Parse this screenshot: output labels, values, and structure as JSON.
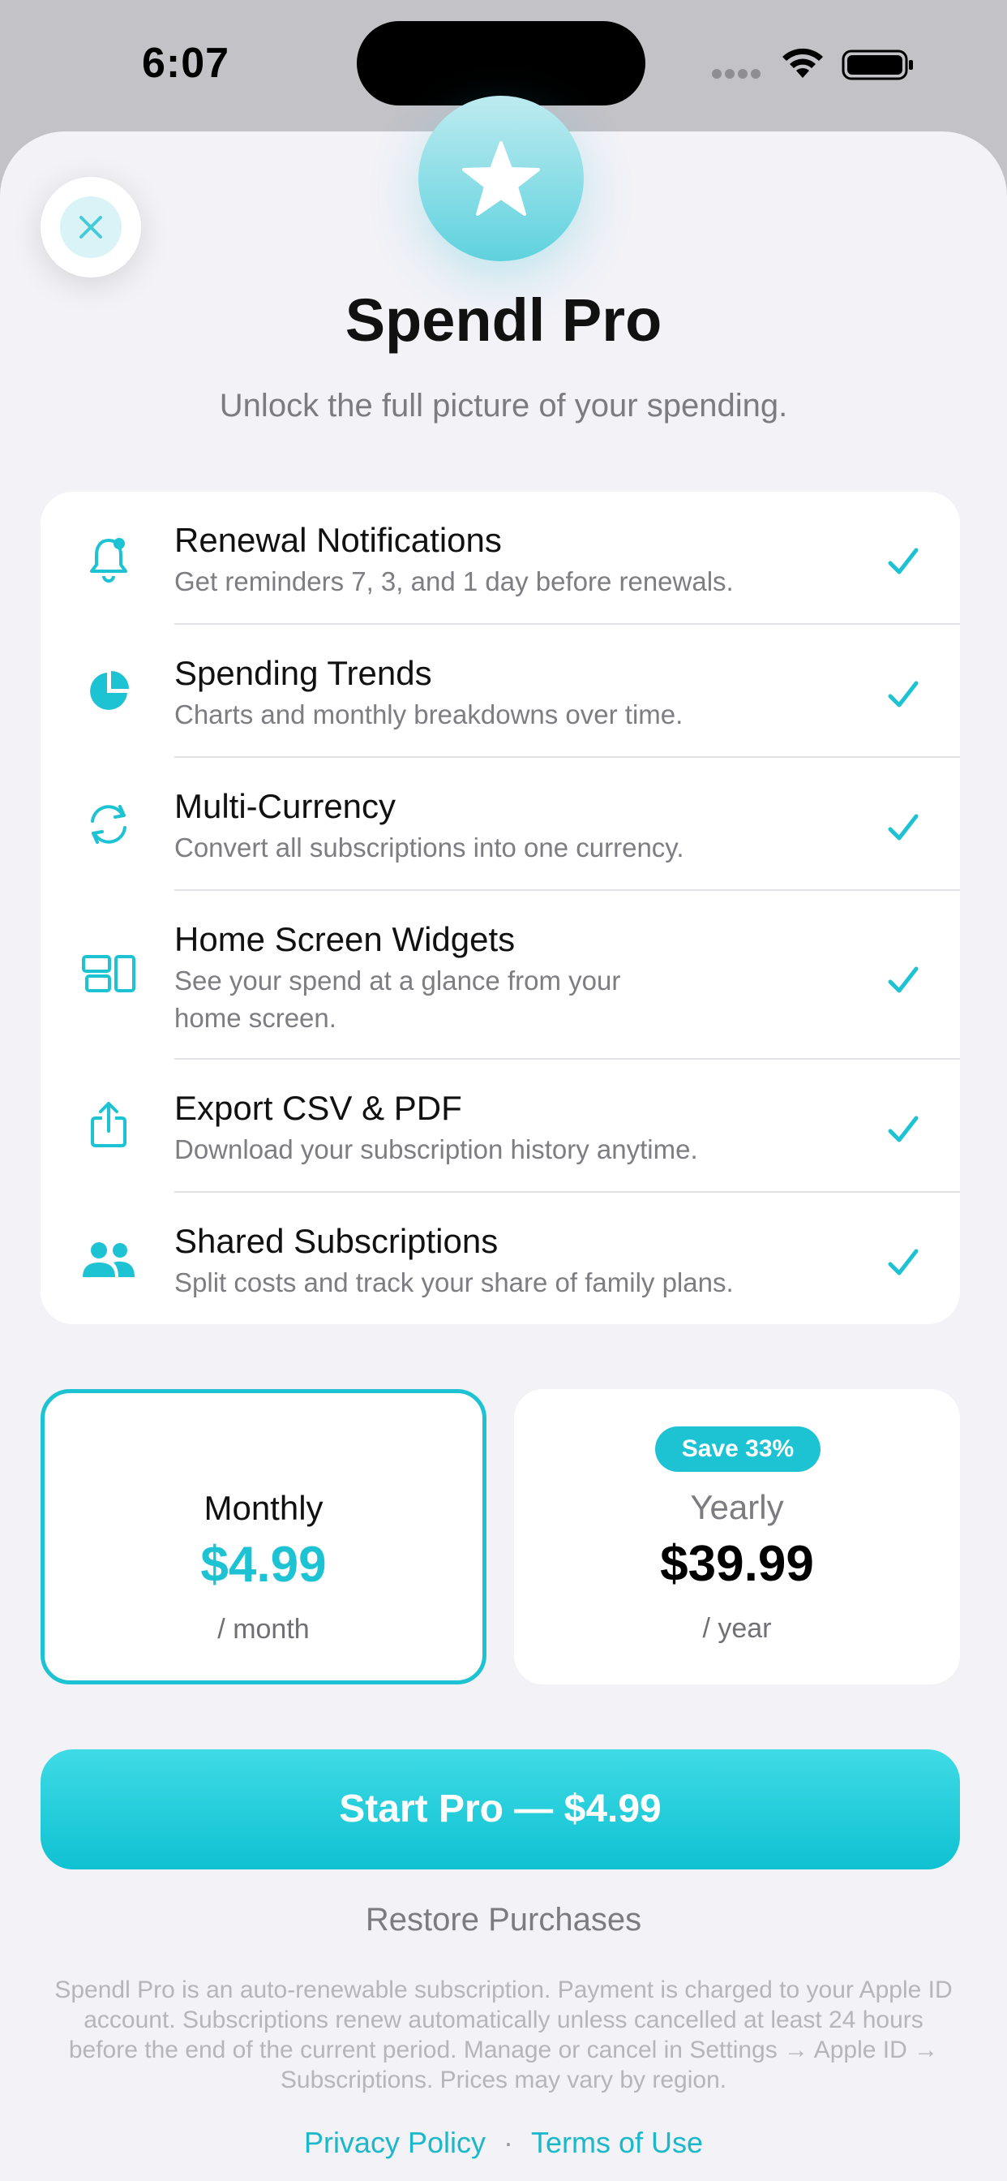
{
  "status_bar": {
    "time": "6:07"
  },
  "header": {
    "title": "Spendl Pro",
    "subtitle": "Unlock the full picture of your spending."
  },
  "features": [
    {
      "title": "Renewal Notifications",
      "desc": "Get reminders 7, 3, and 1 day before renewals.",
      "icon": "bell-icon"
    },
    {
      "title": "Spending Trends",
      "desc": "Charts and monthly breakdowns over time.",
      "icon": "pie-chart-icon"
    },
    {
      "title": "Multi-Currency",
      "desc": "Convert all subscriptions into one currency.",
      "icon": "refresh-icon"
    },
    {
      "title": "Home Screen Widgets",
      "desc": "See your spend at a glance from your home screen.",
      "icon": "widgets-icon"
    },
    {
      "title": "Export CSV & PDF",
      "desc": "Download your subscription history anytime.",
      "icon": "share-icon"
    },
    {
      "title": "Shared Subscriptions",
      "desc": "Split costs and track your share of family plans.",
      "icon": "people-icon"
    }
  ],
  "plans": {
    "monthly": {
      "name": "Monthly",
      "price": "$4.99",
      "period": "/ month",
      "selected": true
    },
    "yearly": {
      "name": "Yearly",
      "price": "$39.99",
      "period": "/ year",
      "badge": "Save 33%",
      "selected": false
    }
  },
  "cta_label": "Start Pro — $4.99",
  "restore_label": "Restore Purchases",
  "legal_text": "Spendl Pro is an auto-renewable subscription. Payment is charged to your Apple ID account. Subscriptions renew automatically unless cancelled at least 24 hours before the end of the current period. Manage or cancel in Settings → Apple ID → Subscriptions. Prices may vary by region.",
  "links": {
    "privacy": "Privacy Policy",
    "separator": "·",
    "terms": "Terms of Use"
  },
  "colors": {
    "accent": "#1ec3d3",
    "background": "#f2f2f7"
  }
}
